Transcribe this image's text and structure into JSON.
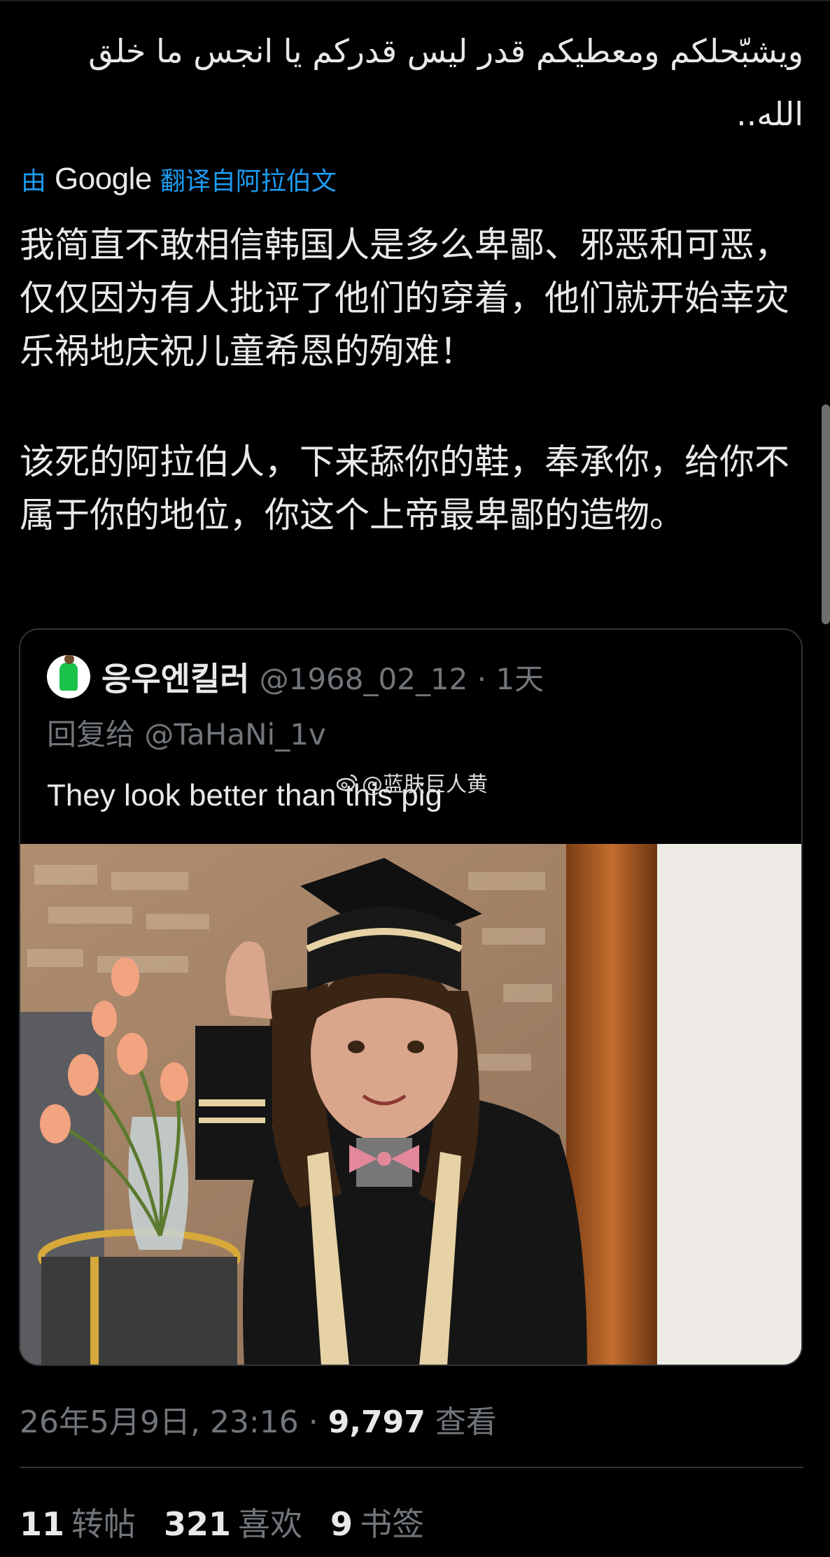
{
  "tweet": {
    "arabic_text": "ويشبّحلكم ومعطيكم قدر ليس قدركم يا انجس ما خلق الله..",
    "translated_prefix": "由",
    "translated_brand": "Google",
    "translated_suffix": "翻译自阿拉伯文",
    "translation_p1": "我简直不敢相信韩国人是多么卑鄙、邪恶和可恶，仅仅因为有人批评了他们的穿着，他们就开始幸灾乐祸地庆祝儿童希恩的殉难！",
    "translation_p2": "该死的阿拉伯人，下来舔你的鞋，奉承你，给你不属于你的地位，你这个上帝最卑鄙的造物。",
    "timestamp": "26年5月9日, 23:16 · ",
    "views_count": "9,797",
    "views_label": "查看",
    "stats": {
      "retweets_count": "11",
      "retweets_label": "转帖",
      "likes_count": "321",
      "likes_label": "喜欢",
      "bookmarks_count": "9",
      "bookmarks_label": "书签"
    }
  },
  "quoted": {
    "name": "응우엔킬러",
    "handle": "@1968_02_12 · 1天",
    "reply_to": "回复给 @TaHaNi_1v",
    "text": "They look better than this pig",
    "watermark": "@蓝肤巨人黄"
  },
  "colors": {
    "background": "#000000",
    "text": "#e7e9ea",
    "muted": "#71767b",
    "link": "#1d9bf0",
    "border": "#2f3336"
  },
  "icons": {
    "weibo_watermark": "weibo-icon",
    "avatar": "avatar"
  }
}
